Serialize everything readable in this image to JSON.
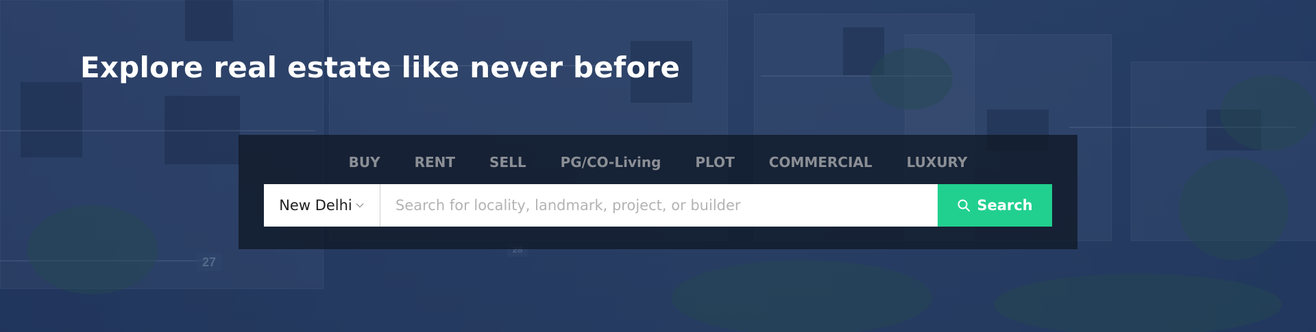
{
  "hero": {
    "headline": "Explore real estate like never before"
  },
  "tabs": [
    {
      "label": "BUY"
    },
    {
      "label": "RENT"
    },
    {
      "label": "SELL"
    },
    {
      "label": "PG/CO-Living"
    },
    {
      "label": "PLOT"
    },
    {
      "label": "COMMERCIAL"
    },
    {
      "label": "LUXURY"
    }
  ],
  "search": {
    "city": "New Delhi",
    "placeholder": "Search for locality, landmark, project, or builder",
    "value": "",
    "button_label": "Search"
  },
  "background": {
    "house_numbers": [
      "27",
      "28"
    ]
  },
  "colors": {
    "accent": "#21d08f",
    "panel": "#101826",
    "tab_text": "#8b8f95"
  }
}
